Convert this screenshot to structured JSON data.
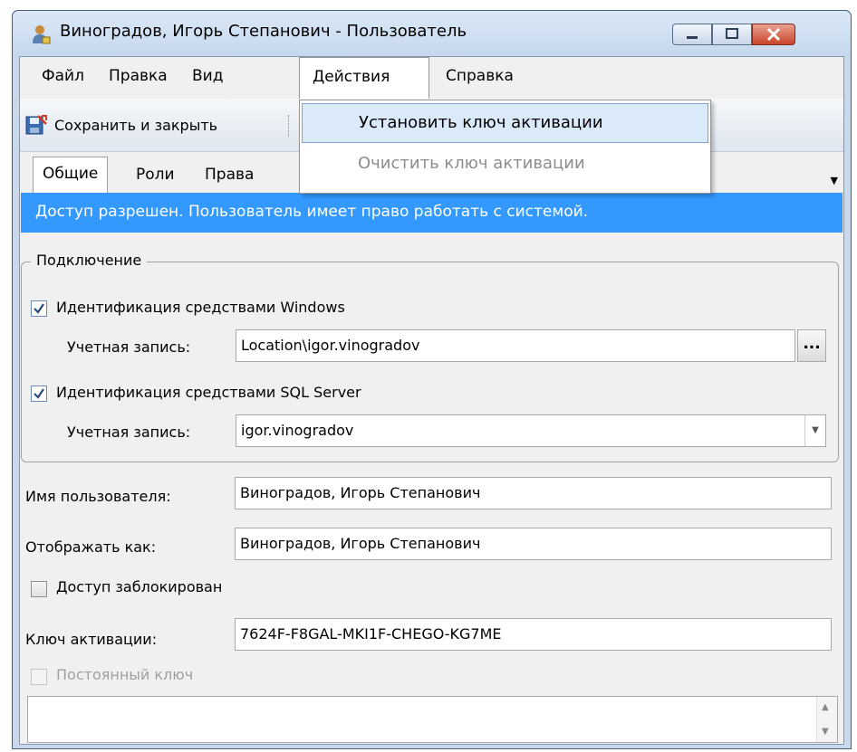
{
  "window": {
    "title": "Виноградов, Игорь Степанович - Пользователь",
    "accent_color": "#3399ff"
  },
  "menu": {
    "items": [
      {
        "label": "Файл"
      },
      {
        "label": "Правка"
      },
      {
        "label": "Вид"
      },
      {
        "label": "Действия"
      },
      {
        "label": "Справка"
      }
    ],
    "open_menu": "Действия",
    "dropdown": {
      "items": [
        {
          "label": "Установить ключ активации",
          "state": "highlighted"
        },
        {
          "label": "Очистить ключ активации",
          "state": "disabled"
        }
      ]
    }
  },
  "toolbar": {
    "save_close_label": "Сохранить и закрыть",
    "save_close_icon": "save-close-icon"
  },
  "tabs": [
    {
      "label": "Общие",
      "active": true
    },
    {
      "label": "Роли"
    },
    {
      "label": "Права"
    }
  ],
  "banner": {
    "text": "Доступ разрешен. Пользователь имеет право работать с системой."
  },
  "connection": {
    "title": "Подключение",
    "windows_auth": {
      "label": "Идентификация средствами Windows",
      "checked": true,
      "account_label": "Учетная запись:",
      "account_value": "Location\\igor.vinogradov",
      "browse_label": "..."
    },
    "sql_auth": {
      "label": "Идентификация средствами SQL Server",
      "checked": true,
      "account_label": "Учетная запись:",
      "account_value": "igor.vinogradov"
    }
  },
  "form": {
    "username_label": "Имя пользователя:",
    "username_value": "Виноградов, Игорь Степанович",
    "display_label": "Отображать как:",
    "display_value": "Виноградов, Игорь Степанович",
    "blocked_label": "Доступ заблокирован",
    "blocked_checked": false,
    "key_label": "Ключ активации:",
    "key_value": "7624F-F8GAL-MKI1F-CHEGO-KG7ME",
    "permanent_label": "Постоянный ключ",
    "permanent_checked": false,
    "permanent_disabled": true
  }
}
